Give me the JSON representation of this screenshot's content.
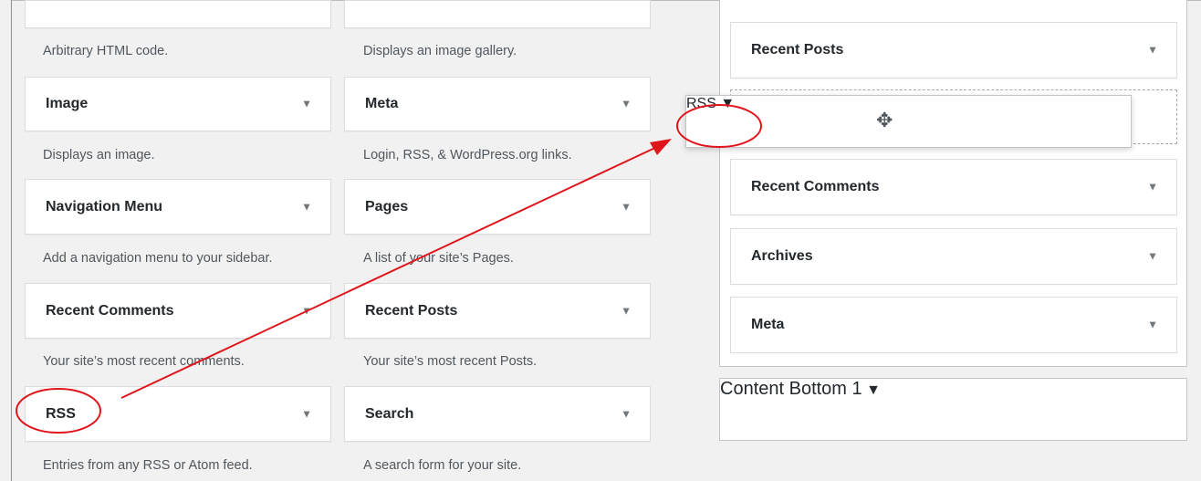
{
  "available_widgets": [
    {
      "title": "",
      "desc": "Arbitrary HTML code."
    },
    {
      "title": "",
      "desc": "Displays an image gallery."
    },
    {
      "title": "Image",
      "desc": "Displays an image."
    },
    {
      "title": "Meta",
      "desc": "Login, RSS, & WordPress.org links."
    },
    {
      "title": "Navigation Menu",
      "desc": "Add a navigation menu to your sidebar."
    },
    {
      "title": "Pages",
      "desc": "A list of your site’s Pages."
    },
    {
      "title": "Recent Comments",
      "desc": "Your site’s most recent comments."
    },
    {
      "title": "Recent Posts",
      "desc": "Your site’s most recent Posts."
    },
    {
      "title": "RSS",
      "desc": "Entries from any RSS or Atom feed."
    },
    {
      "title": "Search",
      "desc": "A search form for your site."
    }
  ],
  "sidebar_widgets": [
    "Recent Posts",
    "Recent Comments",
    "Archives",
    "Meta"
  ],
  "dragging_widget": {
    "title": "RSS"
  },
  "bottom_area": {
    "title": "Content Bottom 1"
  },
  "icons": {
    "expand_arrow": "triangle-down-icon",
    "move": "move-cursor-icon"
  },
  "colors": {
    "annotation": "#e0141b"
  }
}
